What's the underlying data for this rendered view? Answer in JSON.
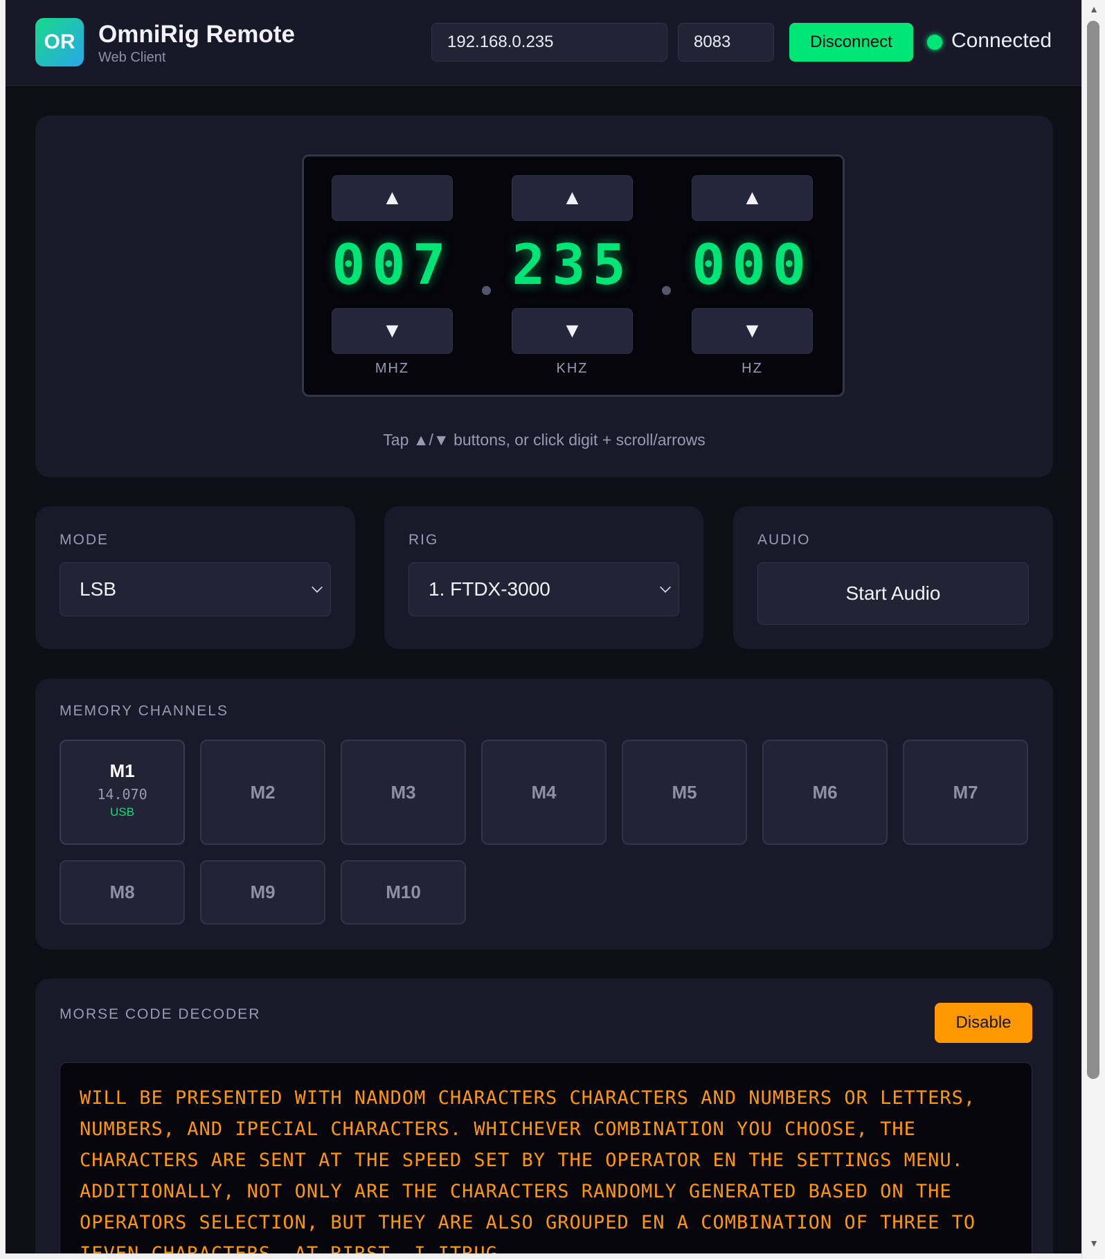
{
  "header": {
    "logo_text": "OR",
    "title": "OmniRig Remote",
    "subtitle": "Web Client",
    "host": "192.168.0.235",
    "port": "8083",
    "disconnect_label": "Disconnect",
    "status": "Connected",
    "status_color": "#00e676"
  },
  "frequency": {
    "up_symbol": "▲",
    "down_symbol": "▼",
    "groups": [
      {
        "value": "007",
        "unit": "MHZ"
      },
      {
        "value": "235",
        "unit": "KHZ"
      },
      {
        "value": "000",
        "unit": "HZ"
      }
    ],
    "hint": "Tap ▲/▼ buttons, or click digit + scroll/arrows",
    "digit_color": "#00e676"
  },
  "mode": {
    "label": "MODE",
    "selected": "LSB"
  },
  "rig": {
    "label": "RIG",
    "selected": "1. FTDX-3000"
  },
  "audio": {
    "label": "AUDIO",
    "button_label": "Start Audio"
  },
  "memory": {
    "label": "MEMORY CHANNELS",
    "channels": [
      {
        "name": "M1",
        "freq": "14.070",
        "mode": "USB"
      },
      {
        "name": "M2"
      },
      {
        "name": "M3"
      },
      {
        "name": "M4"
      },
      {
        "name": "M5"
      },
      {
        "name": "M6"
      },
      {
        "name": "M7"
      },
      {
        "name": "M8"
      },
      {
        "name": "M9"
      },
      {
        "name": "M10"
      }
    ]
  },
  "morse": {
    "label": "MORSE CODE DECODER",
    "toggle_label": "Disable",
    "accent_color": "#ff9800",
    "text": "WILL BE PRESENTED WITH NANDOM CHARACTERS CHARACTERS AND NUMBERS OR LETTERS, NUMBERS, AND IPECIAL CHARACTERS. WHICHEVER COMBINATION YOU CHOOSE, THE CHARACTERS ARE SENT AT THE SPEED SET BY THE OPERATOR EN THE SETTINGS MENU. ADDITIONALLY, NOT ONLY ARE THE CHARACTERS RANDOMLY GENERATED BASED ON THE OPERATORS SELECTION, BUT THEY ARE ALSO GROUPED EN A COMBINATION OF THREE TO IEVEN CHARACTERS. AT RIRST, I ITRUG"
  }
}
